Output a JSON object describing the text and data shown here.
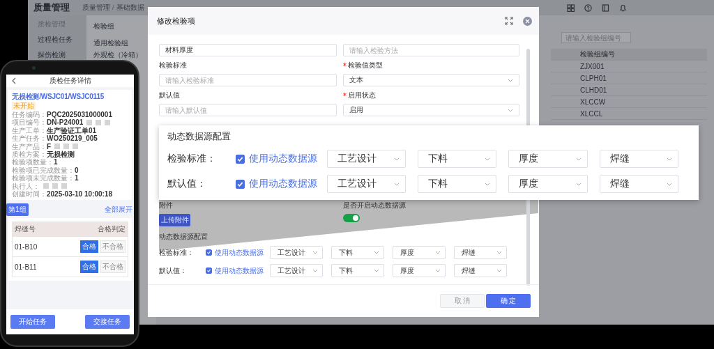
{
  "app": {
    "title": "质量管理",
    "breadcrumbs": [
      "质量管理",
      "基础数据"
    ],
    "breadcrumb_separator": "/",
    "sidebar": {
      "heading": "质检管理",
      "items": [
        "过程检任务",
        "探伤检测"
      ]
    },
    "groups": {
      "title": "检验组",
      "items": [
        "通用检验组",
        "外观检（冷箱）"
      ]
    },
    "table": {
      "search_placeholder": "请输入检验组编号",
      "columns": [
        "检验组编号"
      ],
      "rows": [
        [
          "ZJX001"
        ],
        [
          "CLPH01"
        ],
        [
          "CLHD01"
        ],
        [
          "XLCCW"
        ],
        [
          "XLCCL"
        ]
      ]
    }
  },
  "dialog": {
    "title": "修改检验项",
    "fields": [
      {
        "kind": "input",
        "value": "材料厚度"
      },
      {
        "kind": "input",
        "placeholder": "请输入检验方法"
      },
      {
        "kind": "input",
        "label": "检验标准",
        "required": false,
        "placeholder": "请输入检验标准"
      },
      {
        "kind": "select",
        "label": "检验值类型",
        "required": true,
        "value": "文本"
      },
      {
        "kind": "input",
        "label": "默认值",
        "required": false,
        "placeholder": "请输入默认值"
      },
      {
        "kind": "select",
        "label": "启用状态",
        "required": true,
        "value": "启用"
      }
    ],
    "attachment": {
      "label": "附件",
      "button": "上传附件"
    },
    "dynamic_toggle": {
      "label": "是否开启动态数据源",
      "on": true
    },
    "dynamic_config": {
      "title": "动态数据源配置",
      "rows": [
        {
          "label": "检验标准：",
          "checked": true,
          "checkbox_label": "使用动态数据源",
          "selects": [
            "工艺设计",
            "下料",
            "厚度",
            "焊缝"
          ]
        },
        {
          "label": "默认值：",
          "checked": true,
          "checkbox_label": "使用动态数据源",
          "selects": [
            "工艺设计",
            "下料",
            "厚度",
            "焊缝"
          ]
        }
      ]
    },
    "buttons": [
      {
        "label": "取 消",
        "kind": "secondary"
      },
      {
        "label": "确 定",
        "kind": "primary"
      }
    ]
  },
  "callout": {
    "title": "动态数据源配置",
    "rows": [
      {
        "label": "检验标准：",
        "checked": true,
        "checkbox_label": "使用动态数据源",
        "selects": [
          "工艺设计",
          "下料",
          "厚度",
          "焊缝"
        ]
      },
      {
        "label": "默认值：",
        "checked": true,
        "checkbox_label": "使用动态数据源",
        "selects": [
          "工艺设计",
          "下料",
          "厚度",
          "焊缝"
        ]
      }
    ]
  },
  "phone": {
    "title": "质检任务详情",
    "task_title": "无损检测/WSJC01/WSJC0115",
    "status": "未开始",
    "details": [
      {
        "label": "任务编码：",
        "value": "PQC2025031000001",
        "masked": false
      },
      {
        "label": "项目编号：",
        "value": "DN-P24001",
        "masked": true
      },
      {
        "label": "生产工单：",
        "value": "生产验证工单01",
        "masked": false
      },
      {
        "label": "生产任务：",
        "value": "WO250219_005",
        "masked": false
      },
      {
        "label": "生产产品：",
        "value": "F",
        "masked": true
      },
      {
        "label": "质检方案：",
        "value": "无损检测",
        "masked": false
      },
      {
        "label": "检验项数量：",
        "value": "1",
        "masked": false
      },
      {
        "label": "检验项已完成数量：",
        "value": "0",
        "masked": false
      },
      {
        "label": "检验项未完成数量：",
        "value": "1",
        "masked": false
      },
      {
        "label": "执行人：",
        "masked": true
      },
      {
        "label": "创建时间：",
        "value": "2025-03-10 10:00:18",
        "masked": false
      }
    ],
    "group_button": "第1组",
    "expand_link": "全部展开",
    "table": {
      "columns": [
        "焊缝号",
        "合格判定"
      ],
      "rows": [
        {
          "weld": "01-B10",
          "options": [
            {
              "label": "合格",
              "selected": true
            },
            {
              "label": "不合格",
              "selected": false
            }
          ]
        },
        {
          "weld": "01-B11",
          "options": [
            {
              "label": "合格",
              "selected": true
            },
            {
              "label": "不合格",
              "selected": false
            }
          ]
        }
      ]
    },
    "buttons": [
      "开始任务",
      "交接任务"
    ]
  }
}
